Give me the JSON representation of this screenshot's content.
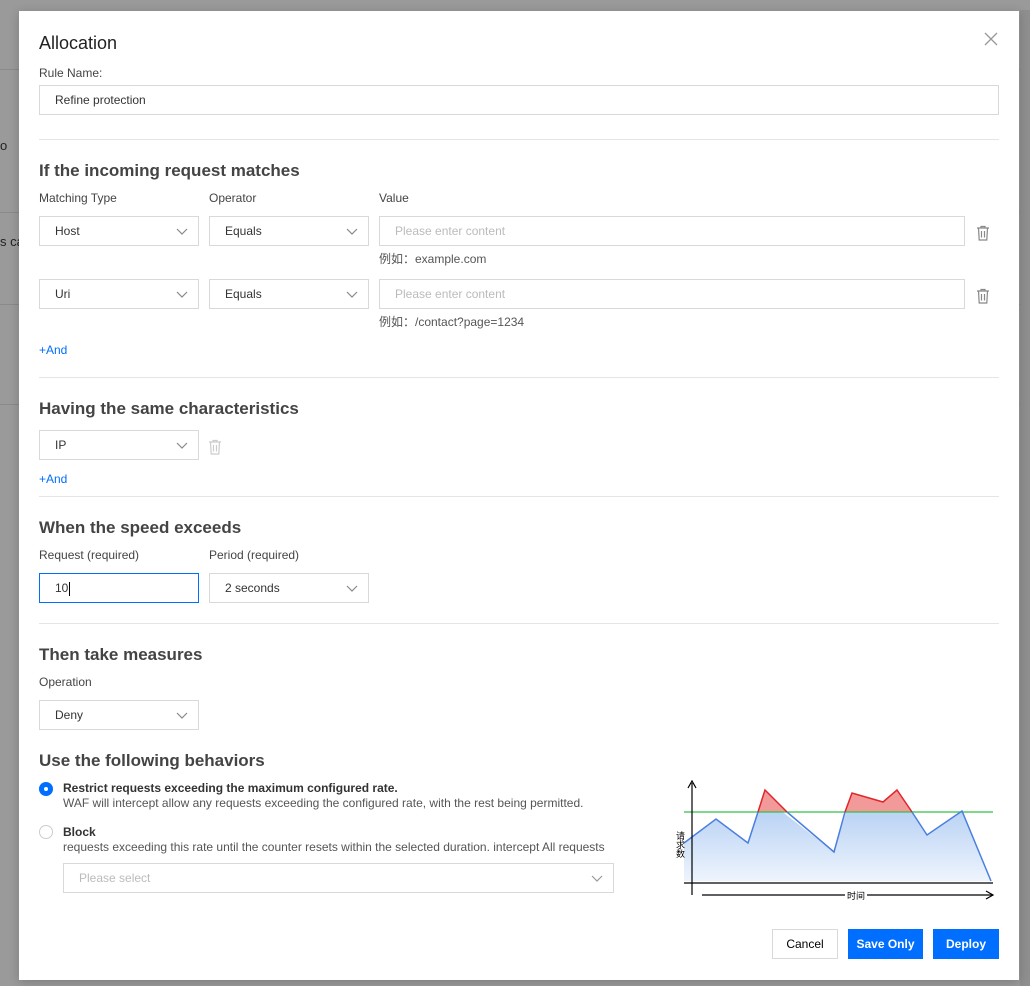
{
  "background": {
    "frag1": "o",
    "frag2": "s ca"
  },
  "modal": {
    "title": "Allocation",
    "rule_name_label": "Rule Name:",
    "rule_name_value": "Refine protection"
  },
  "match_section": {
    "heading": "If the incoming request matches",
    "col_type": "Matching Type",
    "col_operator": "Operator",
    "col_value": "Value",
    "rows": [
      {
        "type": "Host",
        "operator": "Equals",
        "placeholder": "Please enter content",
        "hint": "例如：example.com"
      },
      {
        "type": "Uri",
        "operator": "Equals",
        "placeholder": "Please enter content",
        "hint": "例如：/contact?page=1234"
      }
    ],
    "add_label": "+And"
  },
  "characteristics_section": {
    "heading": "Having the same characteristics",
    "value": "IP",
    "add_label": "+And"
  },
  "speed_section": {
    "heading": "When the speed exceeds",
    "request_label": "Request (required)",
    "request_value": "10",
    "period_label": "Period (required)",
    "period_value": "2 seconds"
  },
  "measures_section": {
    "heading": "Then take measures",
    "operation_label": "Operation",
    "operation_value": "Deny"
  },
  "behaviors_section": {
    "heading": "Use the following behaviors",
    "options": [
      {
        "title": "Restrict requests exceeding the maximum configured rate.",
        "desc": "WAF will intercept allow any requests exceeding the configured rate, with the rest being permitted.",
        "checked": true
      },
      {
        "title": "Block",
        "desc": "requests exceeding this rate until the counter resets within the selected duration. intercept All requests",
        "checked": false
      }
    ],
    "select_placeholder": "Please select",
    "diagram": {
      "y_label": "请求数",
      "x_label": "时间",
      "line_color": "#4a7fe0",
      "threshold_color": "#35c045",
      "over_color": "#e0252b"
    }
  },
  "footer": {
    "cancel": "Cancel",
    "save_only": "Save Only",
    "deploy": "Deploy"
  },
  "colors": {
    "primary": "#006eff"
  }
}
